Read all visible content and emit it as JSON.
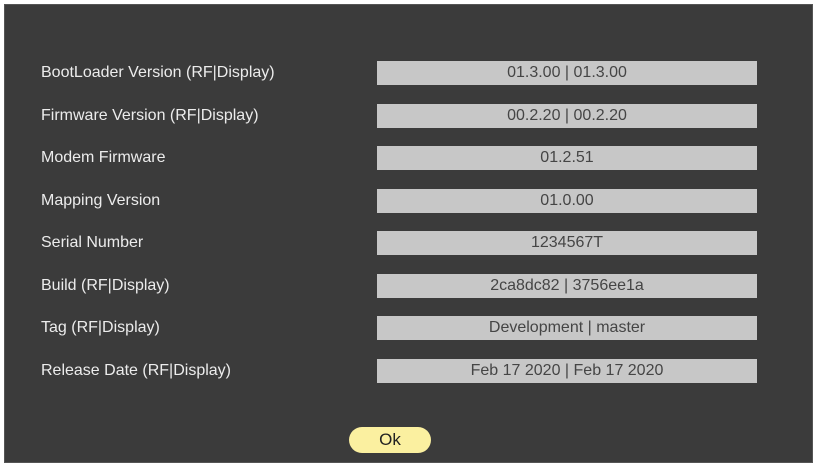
{
  "info": {
    "rows": [
      {
        "label": "BootLoader Version (RF|Display)",
        "value": "01.3.00 | 01.3.00"
      },
      {
        "label": "Firmware Version (RF|Display)",
        "value": "00.2.20 | 00.2.20"
      },
      {
        "label": "Modem Firmware",
        "value": "01.2.51"
      },
      {
        "label": "Mapping Version",
        "value": "01.0.00"
      },
      {
        "label": "Serial Number",
        "value": "1234567T"
      },
      {
        "label": "Build (RF|Display)",
        "value": "2ca8dc82 | 3756ee1a"
      },
      {
        "label": "Tag (RF|Display)",
        "value": "Development | master"
      },
      {
        "label": "Release Date (RF|Display)",
        "value": "Feb 17 2020 | Feb 17 2020"
      }
    ]
  },
  "ok_label": "Ok",
  "colors": {
    "panel_background": "#3b3b3b",
    "value_field": "#c7c7c7",
    "ok_button": "#fbf0a0"
  }
}
